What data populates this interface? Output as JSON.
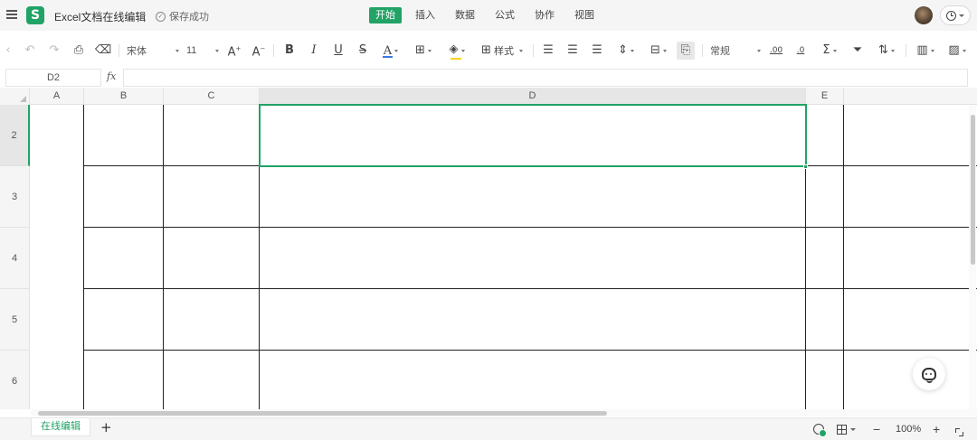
{
  "app": {
    "logo_letter": "S",
    "doc_title": "Excel文档在线编辑",
    "save_status": "保存成功",
    "accent_color": "#21a366"
  },
  "menu": {
    "tabs": [
      {
        "label": "开始",
        "active": true
      },
      {
        "label": "插入",
        "active": false
      },
      {
        "label": "数据",
        "active": false
      },
      {
        "label": "公式",
        "active": false
      },
      {
        "label": "协作",
        "active": false
      },
      {
        "label": "视图",
        "active": false
      }
    ]
  },
  "toolbar": {
    "font_name": "宋体",
    "font_size": "11",
    "style_label": "样式",
    "number_format": "常规",
    "icons": [
      "scroll-left-icon",
      "undo-icon",
      "redo-icon",
      "format-painter-icon",
      "clear-format-icon",
      "font-name-select",
      "font-size-select",
      "increase-font-icon",
      "decrease-font-icon",
      "bold-icon",
      "italic-icon",
      "underline-icon",
      "strikethrough-icon",
      "font-color-icon",
      "border-icon",
      "fill-color-icon",
      "cell-style-icon",
      "align-left-icon",
      "align-center-icon",
      "align-right-icon",
      "vertical-align-icon",
      "merge-cells-icon",
      "wrap-text-icon",
      "number-format-select",
      "decrease-decimal-icon",
      "increase-decimal-icon",
      "sum-icon",
      "filter-icon",
      "sort-icon",
      "chart-icon",
      "image-icon"
    ]
  },
  "formula_bar": {
    "cell_ref": "D2",
    "fx_label": "fx",
    "value": ""
  },
  "grid": {
    "columns": [
      "A",
      "B",
      "C",
      "D",
      "E"
    ],
    "selected_column": "D",
    "rows": [
      "2",
      "3",
      "4",
      "5",
      "6"
    ],
    "selected_row": "2",
    "selected_cell": "D2"
  },
  "status_bar": {
    "sheet_tab": "在线编辑",
    "add_sheet": "+",
    "zoom": "100%",
    "zoom_minus": "−",
    "zoom_plus": "+"
  }
}
